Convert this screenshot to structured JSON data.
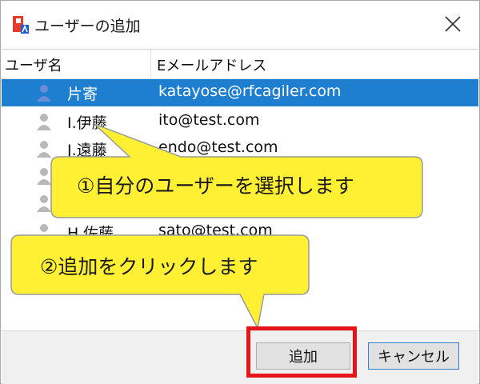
{
  "window": {
    "title": "ユーザーの追加"
  },
  "columns": {
    "user": "ユーザ名",
    "email": "Eメールアドレス"
  },
  "rows": [
    {
      "name": "片寄",
      "email": "katayose@rfcagiler.com",
      "selected": true
    },
    {
      "name": "I.伊藤",
      "email": "ito@test.com",
      "selected": false
    },
    {
      "name": "J.遠藤",
      "email": "endo@test.com",
      "selected": false
    },
    {
      "name": "",
      "email": "",
      "selected": false
    },
    {
      "name": "",
      "email": "",
      "selected": false
    },
    {
      "name": "H.佐藤",
      "email": "sato@test.com",
      "selected": false
    }
  ],
  "buttons": {
    "add": "追加",
    "cancel": "キャンセル"
  },
  "callouts": {
    "select_user": "①自分のユーザーを選択します",
    "click_add": "②追加をクリックします"
  },
  "colors": {
    "selection": "#1e7fd0",
    "callout_fill": "#fff033",
    "highlight": "#e8141c"
  }
}
